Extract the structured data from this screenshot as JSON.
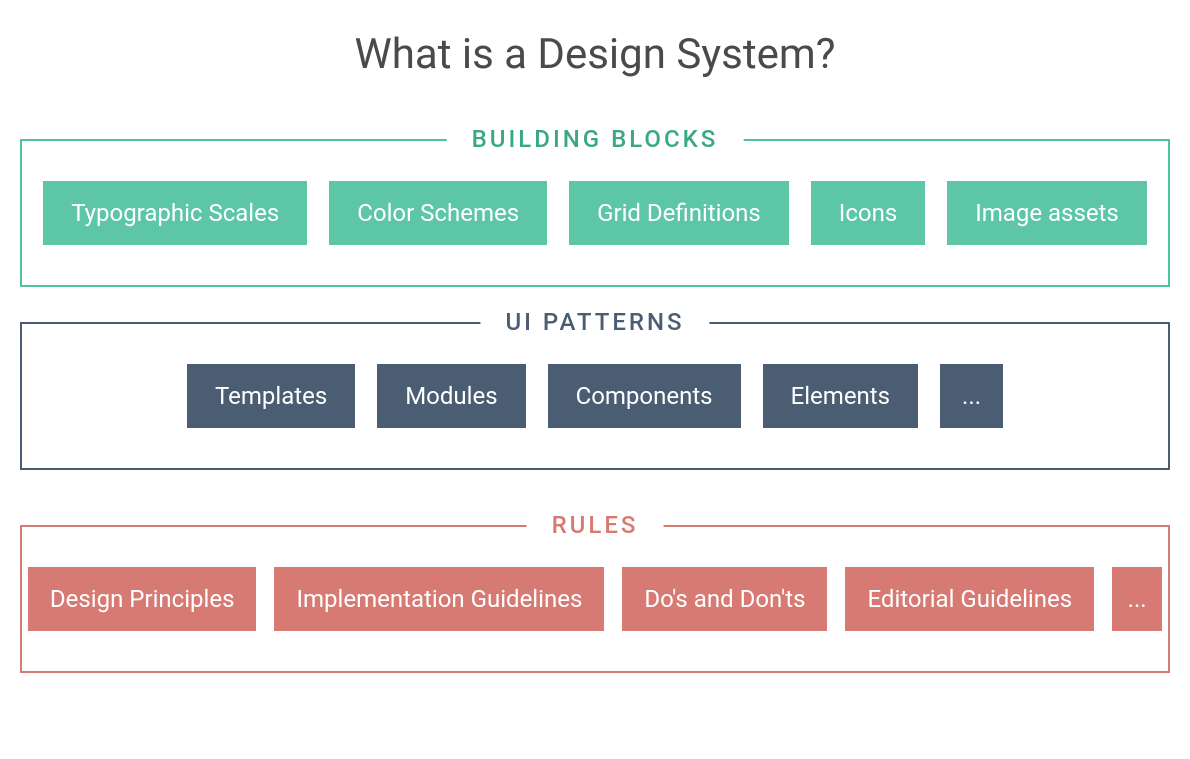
{
  "title": "What is a Design System?",
  "sections": {
    "building_blocks": {
      "label": "BUILDING BLOCKS",
      "items": [
        "Typographic Scales",
        "Color Schemes",
        "Grid Definitions",
        "Icons",
        "Image assets"
      ]
    },
    "ui_patterns": {
      "label": "UI PATTERNS",
      "items": [
        "Templates",
        "Modules",
        "Components",
        "Elements",
        "..."
      ]
    },
    "rules": {
      "label": "RULES",
      "items": [
        "Design Principles",
        "Implementation Guidelines",
        "Do's and Don'ts",
        "Editorial Guidelines",
        "..."
      ]
    }
  }
}
